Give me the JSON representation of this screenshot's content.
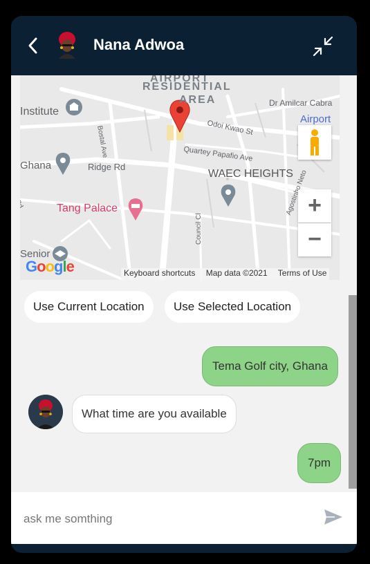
{
  "header": {
    "contact_name": "Nana Adwoa",
    "back_icon": "chevron-left-icon",
    "minimize_icon": "minimize-arrows-icon"
  },
  "map": {
    "labels": {
      "airport_residential": "AIRPORT",
      "residential": "RESIDENTIAL",
      "area": "AREA",
      "institute": "Institute",
      "dr_amilcar": "Dr Amilcar Cabra",
      "airport": "Airport",
      "odoi_kwao": "Odoi Kwao St",
      "bostal_ave": "Bostal Ave",
      "quartey_papafio": "Quartey Papafio Ave",
      "ghana": "Ghana",
      "ridge_rd": "Ridge Rd",
      "waec_heights": "WAEC HEIGHTS",
      "tang_palace": "Tang Palace",
      "council_cl": "Council Cl",
      "senior": "Senior",
      "agostinho_neto": "Agostinho Neto",
      "rd": "Rd"
    },
    "footer": {
      "keyboard_shortcuts": "Keyboard shortcuts",
      "map_data": "Map data ©2021",
      "terms": "Terms of Use"
    },
    "google_logo": "Google",
    "zoom_in": "+",
    "zoom_out": "−"
  },
  "location_buttons": {
    "current": "Use Current Location",
    "selected": "Use Selected Location"
  },
  "messages": [
    {
      "from": "user",
      "text": "Tema Golf city, Ghana"
    },
    {
      "from": "bot",
      "text": "What time are you available"
    },
    {
      "from": "user",
      "text": "7pm"
    }
  ],
  "input": {
    "placeholder": "ask me somthing",
    "send_icon": "send-icon"
  },
  "colors": {
    "header_bg": "#0b2033",
    "chat_bg": "#f2f2f2",
    "user_bubble": "#8ed488",
    "bot_bubble": "#ffffff",
    "map_pin": "#ea4335"
  }
}
